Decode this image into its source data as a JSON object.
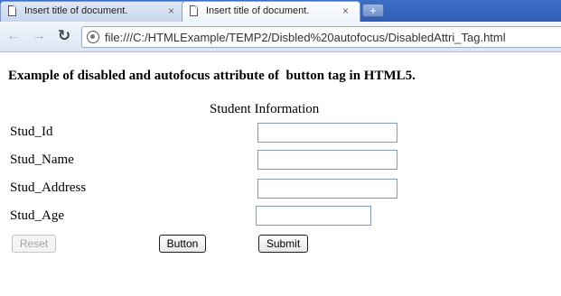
{
  "browser": {
    "tabs": [
      {
        "title": "Insert title of document.",
        "close": "×"
      },
      {
        "title": "Insert title of document.",
        "close": "×"
      }
    ],
    "new_tab_label": "+",
    "nav": {
      "back": "←",
      "forward": "→",
      "reload": "↻"
    },
    "url": "file:///C:/HTMLExample/TEMP2/Disbled%20autofocus/DisabledAttri_Tag.html"
  },
  "page": {
    "heading": "Example of disabled and autofocus attribute of  button tag in HTML5.",
    "form_caption": "Student Information",
    "fields": [
      {
        "label": "Stud_Id",
        "value": ""
      },
      {
        "label": "Stud_Name",
        "value": ""
      },
      {
        "label": "Stud_Address",
        "value": ""
      },
      {
        "label": "Stud_Age",
        "value": ""
      }
    ],
    "buttons": {
      "reset": "Reset",
      "button": "Button",
      "submit": "Submit"
    }
  }
}
